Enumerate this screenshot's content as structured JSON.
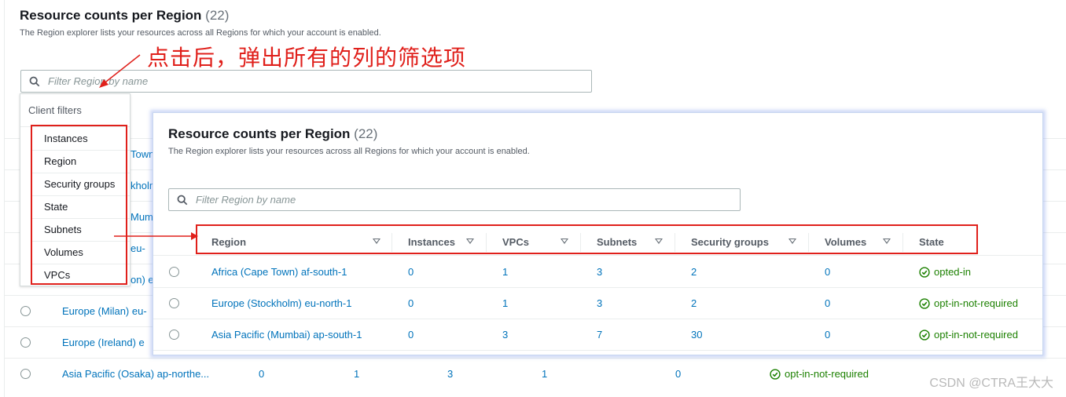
{
  "base": {
    "title": "Resource counts per Region",
    "count": "(22)",
    "description": "The Region explorer lists your resources across all Regions for which your account is enabled.",
    "filter_placeholder": "Filter Region by name",
    "peek_rows": [
      "Town",
      "kholm",
      "Mumb",
      "eu-",
      "on) e"
    ],
    "rows": [
      {
        "region": "Europe (Milan) eu-",
        "instances": "",
        "vpcs": "",
        "subnets": "",
        "security_groups": "",
        "volumes": "",
        "state": ""
      },
      {
        "region": "Europe (Ireland) e",
        "instances": "",
        "vpcs": "",
        "subnets": "",
        "security_groups": "",
        "volumes": "",
        "state": ""
      },
      {
        "region": "Asia Pacific (Osaka) ap-northe...",
        "instances": "0",
        "vpcs": "1",
        "subnets": "3",
        "security_groups": "1",
        "volumes": "0",
        "state": "opt-in-not-required"
      }
    ]
  },
  "annotation": "点击后，弹出所有的列的筛选项",
  "dropdown": {
    "header": "Client filters",
    "options": [
      "Instances",
      "Region",
      "Security groups",
      "State",
      "Subnets",
      "Volumes",
      "VPCs"
    ]
  },
  "popup": {
    "title": "Resource counts per Region",
    "count": "(22)",
    "description": "The Region explorer lists your resources across all Regions for which your account is enabled.",
    "filter_placeholder": "Filter Region by name",
    "columns": [
      "Region",
      "Instances",
      "VPCs",
      "Subnets",
      "Security groups",
      "Volumes",
      "State"
    ],
    "rows": [
      {
        "region": "Africa (Cape Town) af-south-1",
        "instances": "0",
        "vpcs": "1",
        "subnets": "3",
        "security_groups": "2",
        "volumes": "0",
        "state": "opted-in"
      },
      {
        "region": "Europe (Stockholm) eu-north-1",
        "instances": "0",
        "vpcs": "1",
        "subnets": "3",
        "security_groups": "2",
        "volumes": "0",
        "state": "opt-in-not-required"
      },
      {
        "region": "Asia Pacific (Mumbai) ap-south-1",
        "instances": "0",
        "vpcs": "3",
        "subnets": "7",
        "security_groups": "30",
        "volumes": "0",
        "state": "opt-in-not-required"
      }
    ]
  },
  "watermark": "CSDN @CTRA王大大",
  "colors": {
    "link": "#0073bb",
    "success": "#1d8102",
    "annotation_red": "#e0201b"
  }
}
